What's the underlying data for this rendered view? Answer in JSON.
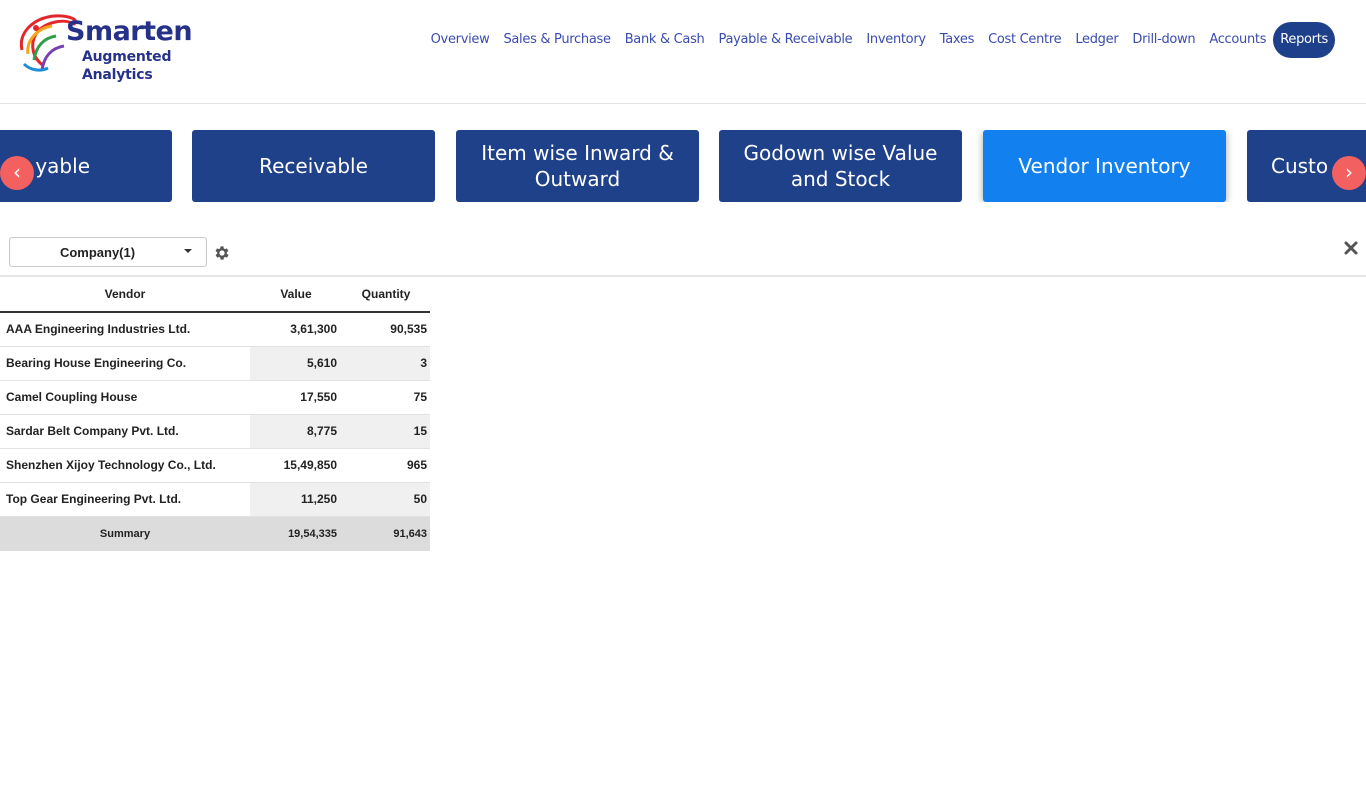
{
  "brand": {
    "title": "Smarten",
    "subtitle": "Augmented Analytics"
  },
  "nav": {
    "items": [
      {
        "label": "Overview"
      },
      {
        "label": "Sales & Purchase"
      },
      {
        "label": "Bank & Cash"
      },
      {
        "label": "Payable & Receivable"
      },
      {
        "label": "Inventory"
      },
      {
        "label": "Taxes"
      },
      {
        "label": "Cost Centre"
      },
      {
        "label": "Ledger"
      },
      {
        "label": "Drill-down"
      },
      {
        "label": "Accounts"
      },
      {
        "label": "Reports",
        "active": true
      }
    ]
  },
  "carousel": {
    "tiles": [
      {
        "label": "Payable",
        "visible_text": "yable"
      },
      {
        "label": "Receivable"
      },
      {
        "label": "Item wise Inward & Outward"
      },
      {
        "label": "Godown wise Value and Stock"
      },
      {
        "label": "Vendor Inventory",
        "active": true
      },
      {
        "label": "Customer",
        "visible_text": "Custo"
      }
    ],
    "prev_label": "‹",
    "next_label": "›"
  },
  "filter": {
    "company_label": "Company(1)"
  },
  "table": {
    "headers": [
      "Vendor",
      "Value",
      "Quantity"
    ],
    "rows": [
      [
        "AAA Engineering Industries Ltd.",
        "3,61,300",
        "90,535"
      ],
      [
        "Bearing House Engineering Co.",
        "5,610",
        "3"
      ],
      [
        "Camel Coupling House",
        "17,550",
        "75"
      ],
      [
        "Sardar Belt Company Pvt. Ltd.",
        "8,775",
        "15"
      ],
      [
        "Shenzhen Xijoy Technology Co., Ltd.",
        "15,49,850",
        "965"
      ],
      [
        "Top Gear Engineering Pvt. Ltd.",
        "11,250",
        "50"
      ]
    ],
    "summary": [
      "Summary",
      "19,54,335",
      "91,643"
    ]
  },
  "colors": {
    "brand": "#26318a",
    "nav_text": "#3a4cae",
    "tile": "#1f418a",
    "tile_active": "#1380ef",
    "arrow": "#f2615f"
  }
}
